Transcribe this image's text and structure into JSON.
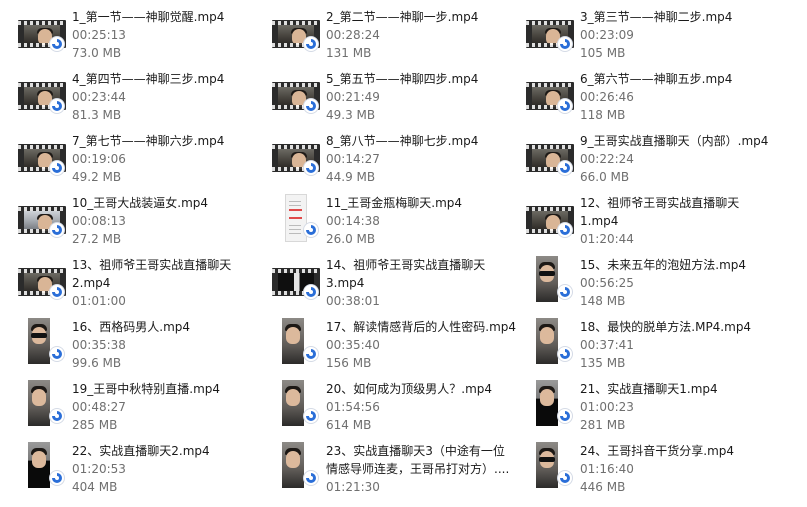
{
  "files": [
    {
      "name": "1_第一节——神聊觉醒.mp4",
      "duration": "00:25:13",
      "size": "73.0 MB",
      "thumb": "film"
    },
    {
      "name": "2_第二节——神聊一步.mp4",
      "duration": "00:28:24",
      "size": "131 MB",
      "thumb": "film"
    },
    {
      "name": "3_第三节——神聊二步.mp4",
      "duration": "00:23:09",
      "size": "105 MB",
      "thumb": "film"
    },
    {
      "name": "4_第四节——神聊三步.mp4",
      "duration": "00:23:44",
      "size": "81.3 MB",
      "thumb": "film"
    },
    {
      "name": "5_第五节——神聊四步.mp4",
      "duration": "00:21:49",
      "size": "49.3 MB",
      "thumb": "film"
    },
    {
      "name": "6_第六节——神聊五步.mp4",
      "duration": "00:26:46",
      "size": "118 MB",
      "thumb": "film"
    },
    {
      "name": "7_第七节——神聊六步.mp4",
      "duration": "00:19:06",
      "size": "49.2 MB",
      "thumb": "film"
    },
    {
      "name": "8_第八节——神聊七步.mp4",
      "duration": "00:14:27",
      "size": "44.9 MB",
      "thumb": "film"
    },
    {
      "name": "9_王哥实战直播聊天（内部）.mp4",
      "duration": "00:22:24",
      "size": "66.0 MB",
      "thumb": "film"
    },
    {
      "name": "10_王哥大战装逼女.mp4",
      "duration": "00:08:13",
      "size": "27.2 MB",
      "thumb": "film-light"
    },
    {
      "name": "11_王哥金瓶梅聊天.mp4",
      "duration": "00:14:38",
      "size": "26.0 MB",
      "thumb": "document"
    },
    {
      "name": "12、祖师爷王哥实战直播聊天1.mp4",
      "duration": "01:20:44",
      "size": "",
      "thumb": "film",
      "wrap": true
    },
    {
      "name": "13、祖师爷王哥实战直播聊天2.mp4",
      "duration": "01:01:00",
      "size": "",
      "thumb": "film",
      "wrap": true
    },
    {
      "name": "14、祖师爷王哥实战直播聊天3.mp4",
      "duration": "00:38:01",
      "size": "",
      "thumb": "film-screen",
      "wrap": true
    },
    {
      "name": "15、未来五年的泡妞方法.mp4",
      "duration": "00:56:25",
      "size": "148 MB",
      "thumb": "portrait-glasses"
    },
    {
      "name": "16、西格码男人.mp4",
      "duration": "00:35:38",
      "size": "99.6 MB",
      "thumb": "portrait-glasses"
    },
    {
      "name": "17、解读情感背后的人性密码.mp4",
      "duration": "00:35:40",
      "size": "156 MB",
      "thumb": "portrait"
    },
    {
      "name": "18、最快的脱单方法.MP4.mp4",
      "duration": "00:37:41",
      "size": "135 MB",
      "thumb": "portrait"
    },
    {
      "name": "19_王哥中秋特别直播.mp4",
      "duration": "00:48:27",
      "size": "285 MB",
      "thumb": "portrait"
    },
    {
      "name": "20、如何成为顶级男人？.mp4",
      "duration": "01:54:56",
      "size": "614 MB",
      "thumb": "portrait"
    },
    {
      "name": "21、实战直播聊天1.mp4",
      "duration": "01:00:23",
      "size": "281 MB",
      "thumb": "portrait-darkbottom"
    },
    {
      "name": "22、实战直播聊天2.mp4",
      "duration": "01:20:53",
      "size": "404 MB",
      "thumb": "portrait-darkbottom"
    },
    {
      "name": "23、实战直播聊天3（中途有一位情感导师连麦，王哥吊打对方）....",
      "duration": "01:21:30",
      "size": "",
      "thumb": "portrait",
      "wrap": true
    },
    {
      "name": "24、王哥抖音干货分享.mp4",
      "duration": "01:16:40",
      "size": "446 MB",
      "thumb": "portrait-glasses"
    }
  ]
}
